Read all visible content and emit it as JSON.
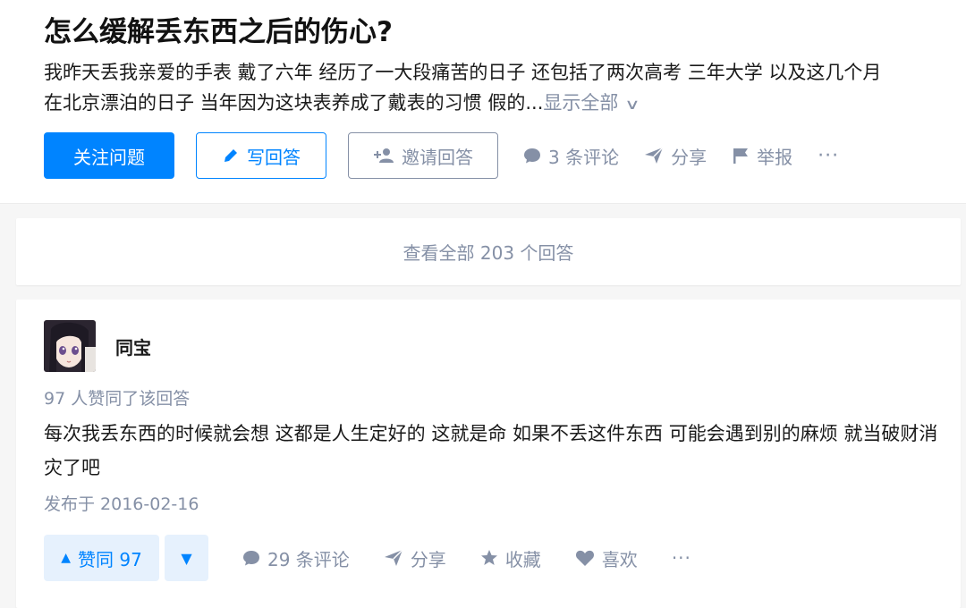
{
  "question": {
    "title": "怎么缓解丢东西之后的伤心?",
    "detail_line1": "我昨天丢我亲爱的手表 戴了六年 经历了一大段痛苦的日子 还包括了两次高考 三年大学 以及这几个月",
    "detail_line2": "在北京漂泊的日子 当年因为这块表养成了戴表的习惯 假的...",
    "show_all": "显示全部",
    "actions": {
      "follow": "关注问题",
      "write": "写回答",
      "invite": "邀请回答",
      "comments": "3 条评论",
      "share": "分享",
      "report": "举报",
      "more": "···"
    }
  },
  "view_all_answers": "查看全部 203 个回答",
  "answer": {
    "author": "同宝",
    "upvote_note": "97 人赞同了该回答",
    "text": "每次我丢东西的时候就会想 这都是人生定好的 这就是命 如果不丢这件东西 可能会遇到别的麻烦 就当破财消灾了吧",
    "published": "发布于 2016-02-16",
    "actions": {
      "upvote": "赞同 97",
      "comments": "29 条评论",
      "share": "分享",
      "collect": "收藏",
      "like": "喜欢",
      "more": "···"
    }
  },
  "colors": {
    "accent": "#0084ff",
    "muted": "#8590a6",
    "vote_bg": "#e6f1fd"
  }
}
